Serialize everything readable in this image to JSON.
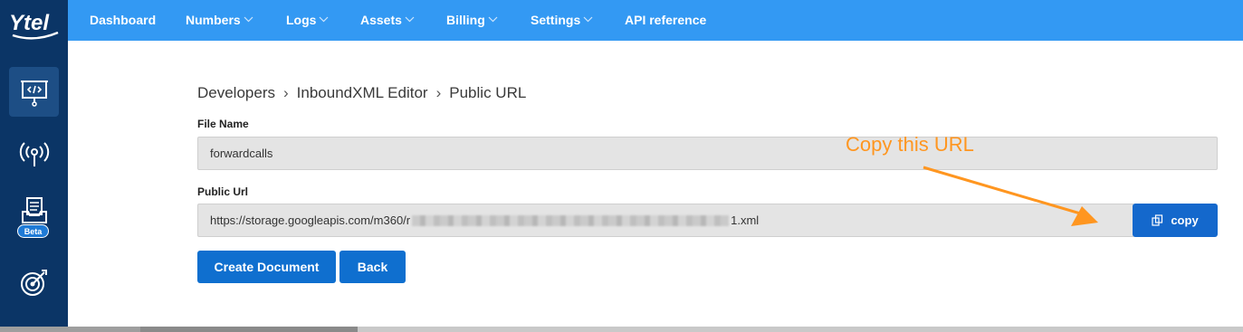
{
  "brand": {
    "logo_text": "Ytel"
  },
  "nav": {
    "items": [
      {
        "label": "Dashboard",
        "has_dropdown": false
      },
      {
        "label": "Numbers",
        "has_dropdown": true
      },
      {
        "label": "Logs",
        "has_dropdown": true
      },
      {
        "label": "Assets",
        "has_dropdown": true
      },
      {
        "label": "Billing",
        "has_dropdown": true
      },
      {
        "label": "Settings",
        "has_dropdown": true
      },
      {
        "label": "API reference",
        "has_dropdown": false
      }
    ]
  },
  "sidebar": {
    "items": [
      {
        "icon": "code-presentation-icon",
        "active": true
      },
      {
        "icon": "broadcast-icon",
        "active": false
      },
      {
        "icon": "inbox-document-icon",
        "active": false,
        "badge": "Beta"
      },
      {
        "icon": "target-icon",
        "active": false
      }
    ]
  },
  "breadcrumb": [
    "Developers",
    "InboundXML Editor",
    "Public URL"
  ],
  "breadcrumb_separator": "›",
  "form": {
    "file_name_label": "File Name",
    "file_name_value": "forwardcalls",
    "public_url_label": "Public Url",
    "public_url_prefix": "https://storage.googleapis.com/m360/r",
    "public_url_suffix": "1.xml",
    "copy_label": "copy"
  },
  "actions": {
    "create_label": "Create Document",
    "back_label": "Back"
  },
  "annotation": {
    "text": "Copy this URL",
    "color": "#ff9620"
  },
  "colors": {
    "nav_bg": "#3399f3",
    "sidebar_bg": "#0b3566",
    "button_bg": "#0f6fcf"
  }
}
